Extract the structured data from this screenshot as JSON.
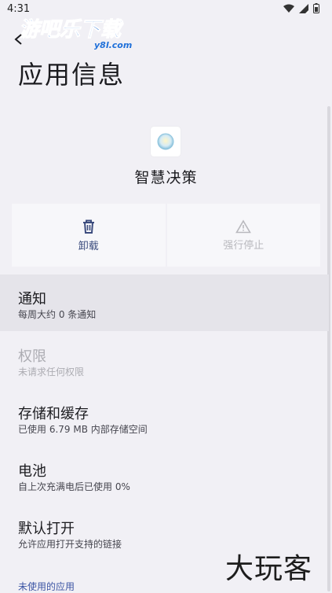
{
  "status": {
    "time": "4:31"
  },
  "watermark": {
    "brand": "游吧乐下载",
    "domain": "y8l.com",
    "corner_text": "大玩客"
  },
  "header": {
    "title": "应用信息"
  },
  "app": {
    "name": "智慧决策"
  },
  "actions": [
    {
      "label": "卸载",
      "icon": "trash-icon",
      "enabled": true
    },
    {
      "label": "强行停止",
      "icon": "warning-icon",
      "enabled": false
    }
  ],
  "settings": [
    {
      "title": "通知",
      "subtitle": "每周大约 0 条通知"
    },
    {
      "title": "权限",
      "subtitle": "未请求任何权限"
    },
    {
      "title": "存储和缓存",
      "subtitle": "已使用 6.79 MB 内部存储空间"
    },
    {
      "title": "电池",
      "subtitle": "自上次充满电后已使用 0%"
    },
    {
      "title": "默认打开",
      "subtitle": "允许应用打开支持的链接"
    }
  ],
  "section": {
    "unused_apps": "未使用的应用"
  },
  "colors": {
    "background": "#f1f0f5",
    "accent": "#3c55a4",
    "logo_blue": "#1e6fd9"
  }
}
